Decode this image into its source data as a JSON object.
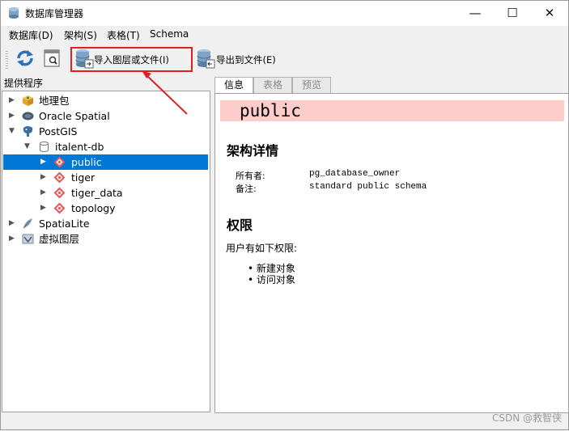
{
  "window": {
    "title": "数据库管理器",
    "minimize": "—",
    "maximize": "☐",
    "close": "✕"
  },
  "menu": {
    "items": [
      "数据库(D)",
      "架构(S)",
      "表格(T)",
      "Schema"
    ]
  },
  "toolbar": {
    "import_label": "导入图层或文件(I)",
    "export_label": "导出到文件(E)"
  },
  "left_panel": {
    "title": "提供程序"
  },
  "tree": {
    "items": [
      {
        "label": "地理包"
      },
      {
        "label": "Oracle Spatial"
      },
      {
        "label": "PostGIS"
      },
      {
        "label": "italent-db"
      },
      {
        "label": "public"
      },
      {
        "label": "tiger"
      },
      {
        "label": "tiger_data"
      },
      {
        "label": "topology"
      },
      {
        "label": "SpatiaLite"
      },
      {
        "label": "虚拟图层"
      }
    ]
  },
  "tabs": [
    "信息",
    "表格",
    "预览"
  ],
  "info": {
    "schema_name": "public",
    "details_heading": "架构详情",
    "owner_label": "所有者:",
    "owner_value": "pg_database_owner",
    "comment_label": "备注:",
    "comment_value": "standard public schema",
    "perm_heading": "权限",
    "perm_text": "用户有如下权限:",
    "perms": [
      "新建对象",
      "访问对象"
    ]
  },
  "watermark": "CSDN @救智侠",
  "colors": {
    "selection": "#0078d7",
    "banner": "#ffcccc",
    "highlight": "#e02020"
  }
}
